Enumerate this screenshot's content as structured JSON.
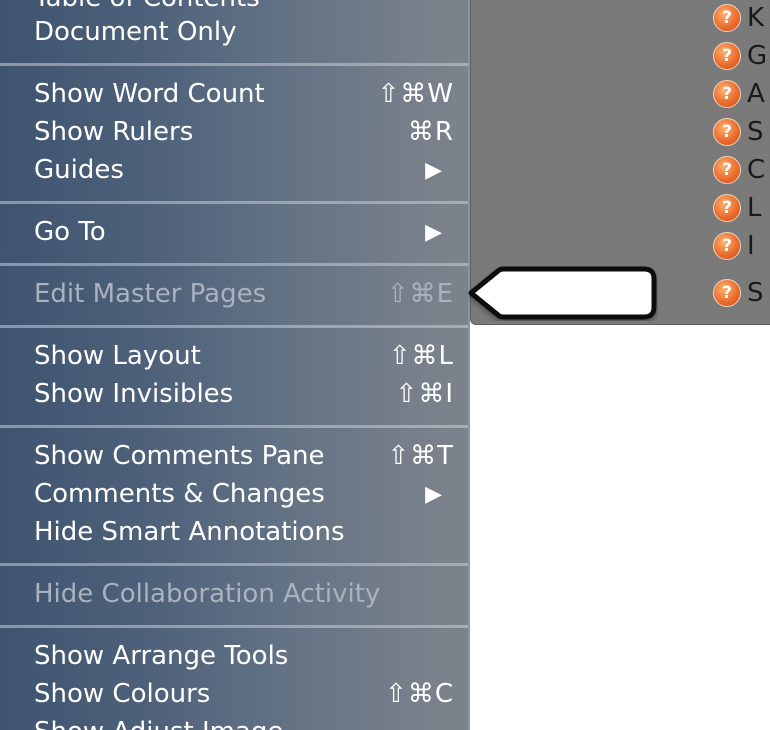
{
  "menu": {
    "partial_top": "Table of Contents",
    "items": [
      {
        "label": "Document Only",
        "shortcut": "",
        "submenu": false,
        "enabled": true
      },
      {
        "label": "Show Word Count",
        "shortcut": "⇧⌘W",
        "submenu": false,
        "enabled": true
      },
      {
        "label": "Show Rulers",
        "shortcut": "⌘R",
        "submenu": false,
        "enabled": true
      },
      {
        "label": "Guides",
        "shortcut": "",
        "submenu": true,
        "enabled": true
      },
      {
        "label": "Go To",
        "shortcut": "",
        "submenu": true,
        "enabled": true
      },
      {
        "label": "Edit Master Pages",
        "shortcut": "⇧⌘E",
        "submenu": false,
        "enabled": false
      },
      {
        "label": "Show Layout",
        "shortcut": "⇧⌘L",
        "submenu": false,
        "enabled": true
      },
      {
        "label": "Show Invisibles",
        "shortcut": "⇧⌘I",
        "submenu": false,
        "enabled": true
      },
      {
        "label": "Show Comments Pane",
        "shortcut": "⇧⌘T",
        "submenu": false,
        "enabled": true
      },
      {
        "label": "Comments & Changes",
        "shortcut": "",
        "submenu": true,
        "enabled": true
      },
      {
        "label": "Hide Smart Annotations",
        "shortcut": "",
        "submenu": false,
        "enabled": true
      },
      {
        "label": "Hide Collaboration Activity",
        "shortcut": "",
        "submenu": false,
        "enabled": false
      },
      {
        "label": "Show Arrange Tools",
        "shortcut": "",
        "submenu": false,
        "enabled": true
      },
      {
        "label": "Show Colours",
        "shortcut": "⇧⌘C",
        "submenu": false,
        "enabled": true
      },
      {
        "label": "Show Adjust Image",
        "shortcut": "",
        "submenu": false,
        "enabled": true
      }
    ],
    "submenu_glyph": "▶"
  },
  "help_list": {
    "icon_glyph": "?",
    "icon": "help-circle-icon",
    "letters": [
      "K",
      "G",
      "A",
      "S",
      "C",
      "L",
      "I",
      "S"
    ]
  },
  "colors": {
    "menu_text": "#ffffff",
    "disabled_text": "#a9b2bd",
    "help_icon": "#e7692a",
    "panel": "#7a7a7a"
  }
}
